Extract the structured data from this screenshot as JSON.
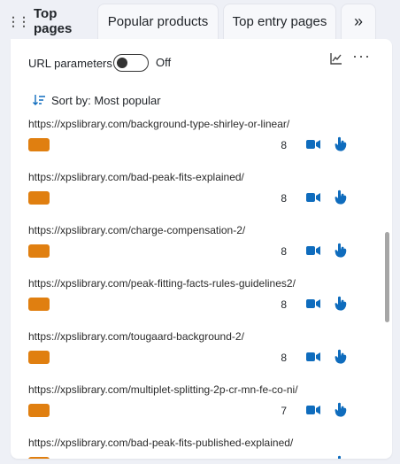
{
  "tabs": [
    {
      "label": "Top pages",
      "active": true
    },
    {
      "label": "Popular products",
      "active": false
    },
    {
      "label": "Top entry pages",
      "active": false
    },
    {
      "label": "»",
      "active": false
    }
  ],
  "toolbar": {
    "url_params_label": "URL parameters",
    "url_params_state": "Off",
    "chart_icon": "line-chart-icon",
    "more_label": "···"
  },
  "sort": {
    "label": "Sort by: Most popular",
    "icon": "sort-descending-icon"
  },
  "rows": [
    {
      "url": "https://xpslibrary.com/background-type-shirley-or-linear/",
      "count": "8"
    },
    {
      "url": "https://xpslibrary.com/bad-peak-fits-explained/",
      "count": "8"
    },
    {
      "url": "https://xpslibrary.com/charge-compensation-2/",
      "count": "8"
    },
    {
      "url": "https://xpslibrary.com/peak-fitting-facts-rules-guidelines2/",
      "count": "8"
    },
    {
      "url": "https://xpslibrary.com/tougaard-background-2/",
      "count": "8"
    },
    {
      "url": "https://xpslibrary.com/multiplet-splitting-2p-cr-mn-fe-co-ni/",
      "count": "7"
    },
    {
      "url": "https://xpslibrary.com/bad-peak-fits-published-explained/",
      "count": ""
    }
  ],
  "colors": {
    "accent": "#0f6cbd",
    "bar": "#e07f10",
    "scroll": "#a6a6a6"
  }
}
